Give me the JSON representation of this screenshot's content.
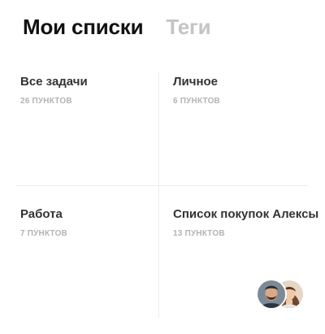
{
  "tabs": [
    {
      "label": "Мои списки",
      "active": true
    },
    {
      "label": "Теги",
      "active": false
    }
  ],
  "lists": [
    {
      "title": "Все задачи",
      "count": "26 ПУНКТОВ"
    },
    {
      "title": "Личное",
      "count": "6 ПУНКТОВ"
    },
    {
      "title": "Работа",
      "count": "7 ПУНКТОВ"
    },
    {
      "title": "Список покупок Алексы",
      "count": "13 ПУНКТОВ",
      "shared_avatars": [
        "avatar-man",
        "avatar-woman"
      ]
    }
  ],
  "colors": {
    "active_tab": "#111111",
    "inactive_tab": "#c4c4c4",
    "title": "#333333",
    "count": "#b3b3b3",
    "divider": "#ececec"
  }
}
